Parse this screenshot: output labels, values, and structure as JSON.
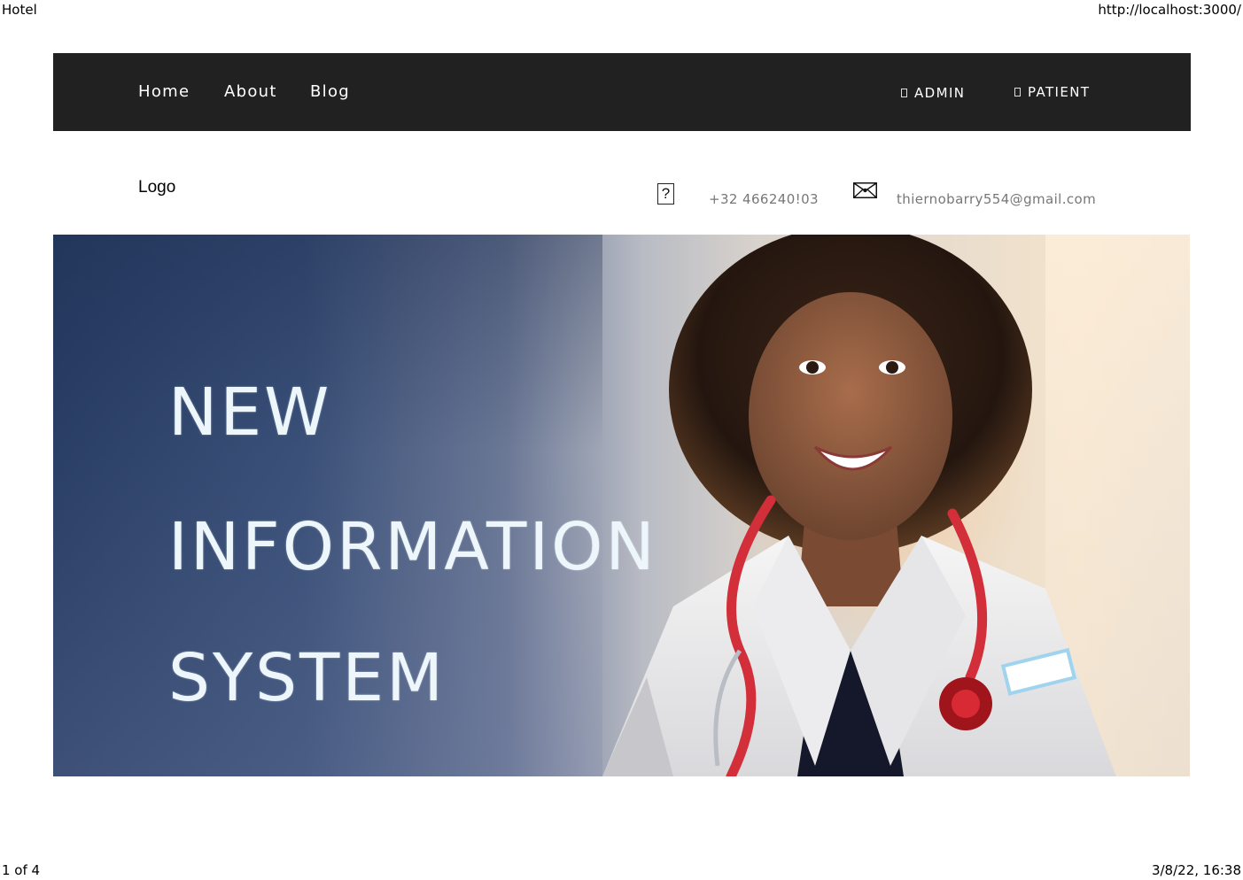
{
  "print": {
    "title": "Hotel",
    "url": "http://localhost:3000/",
    "page_info": "1 of 4",
    "datetime": "3/8/22, 16:38"
  },
  "nav": {
    "links": [
      "Home",
      "About",
      "Blog"
    ],
    "admin_label": "ADMIN",
    "patient_label": "PATIENT",
    "background": "#212121"
  },
  "contact": {
    "logo": "Logo",
    "phone_icon": "?",
    "phone": "+32 466240!03",
    "email": "thiernobarry554@gmail.com"
  },
  "hero": {
    "lines": [
      "NEW",
      "INFORMATION",
      "SYSTEM"
    ],
    "text_color": "#ecf6fb"
  }
}
